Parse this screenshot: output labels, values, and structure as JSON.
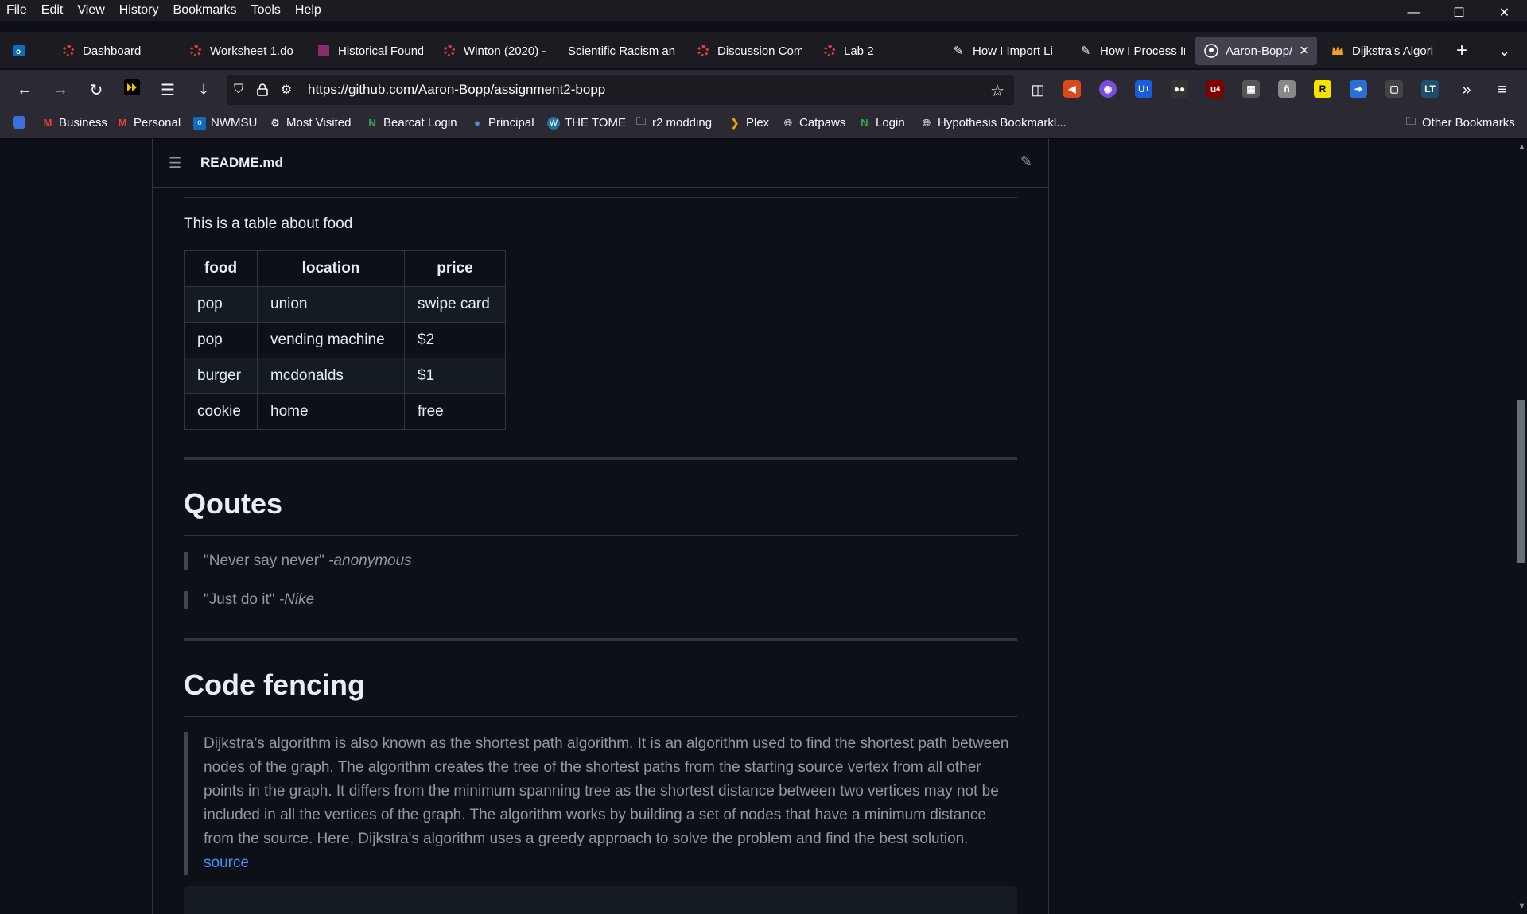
{
  "menubar": {
    "items": [
      "File",
      "Edit",
      "View",
      "History",
      "Bookmarks",
      "Tools",
      "Help"
    ]
  },
  "window_controls": {
    "minimize": "—",
    "maximize": "☐",
    "close": "✕"
  },
  "tabs": [
    {
      "label": "Dashboard",
      "icon": "canvas-ring-icon"
    },
    {
      "label": "Worksheet 1.do",
      "icon": "canvas-ring-icon"
    },
    {
      "label": "Historical Found",
      "icon": "purple-square-icon"
    },
    {
      "label": "Winton (2020) -",
      "icon": "canvas-ring-icon"
    },
    {
      "label": "Scientific Racism an",
      "icon": "none"
    },
    {
      "label": "Discussion Com",
      "icon": "canvas-ring-icon"
    },
    {
      "label": "Lab 2",
      "icon": "canvas-ring-icon"
    },
    {
      "label": "How I Import Li",
      "icon": "pen-icon"
    },
    {
      "label": "How I Process In",
      "icon": "pen-icon"
    },
    {
      "label": "Aaron-Bopp/",
      "icon": "github-icon",
      "active": true
    },
    {
      "label": "Dijkstra's Algori",
      "icon": "crown-icon"
    }
  ],
  "toolbar": {
    "url": "https://github.com/Aaron-Bopp/assignment2-bopp",
    "badges": {
      "ublock": "4",
      "bitwarden": "1"
    }
  },
  "bookmarks": [
    {
      "label": "Business",
      "icon": "gmail-icon"
    },
    {
      "label": "Personal",
      "icon": "gmail-icon"
    },
    {
      "label": "NWMSU",
      "icon": "outlook-icon"
    },
    {
      "label": "Most Visited",
      "icon": "gear-icon"
    },
    {
      "label": "Bearcat Login",
      "icon": "n-icon"
    },
    {
      "label": "Principal",
      "icon": "globe-blue-icon"
    },
    {
      "label": "THE TOME",
      "icon": "wordpress-icon"
    },
    {
      "label": "r2 modding",
      "icon": "folder-icon"
    },
    {
      "label": "Plex",
      "icon": "plex-icon"
    },
    {
      "label": "Catpaws",
      "icon": "globe-icon"
    },
    {
      "label": "Login",
      "icon": "n-icon"
    },
    {
      "label": "Hypothesis Bookmarkl...",
      "icon": "globe-icon"
    }
  ],
  "other_bookmarks": "Other Bookmarks",
  "readme": {
    "filename": "README.md",
    "intro": "This is a table about food",
    "table": {
      "headers": [
        "food",
        "location",
        "price"
      ],
      "rows": [
        [
          "pop",
          "union",
          "swipe card"
        ],
        [
          "pop",
          "vending machine",
          "$2"
        ],
        [
          "burger",
          "mcdonalds",
          "$1"
        ],
        [
          "cookie",
          "home",
          "free"
        ]
      ]
    },
    "quotes_heading": "Qoutes",
    "quotes": [
      {
        "text": "\"Never say never\" ",
        "author": "-anonymous"
      },
      {
        "text": "\"Just do it\" ",
        "author": "-Nike"
      }
    ],
    "code_heading": "Code fencing",
    "paragraph": "Dijkstra’s algorithm is also known as the shortest path algorithm. It is an algorithm used to find the shortest path between nodes of the graph. The algorithm creates the tree of the shortest paths from the starting source vertex from all other points in the graph. It differs from the minimum spanning tree as the shortest distance between two vertices may not be included in all the vertices of the graph. The algorithm works by building a set of nodes that have a minimum distance from the source. Here, Dijkstra's algorithm uses a greedy approach to solve the problem and find the best solution.",
    "source_link": "source"
  },
  "colors": {
    "page_bg": "#0d1117",
    "text": "#e6edf3",
    "muted": "#9198a1",
    "link": "#4493f8",
    "border": "#30363d"
  }
}
